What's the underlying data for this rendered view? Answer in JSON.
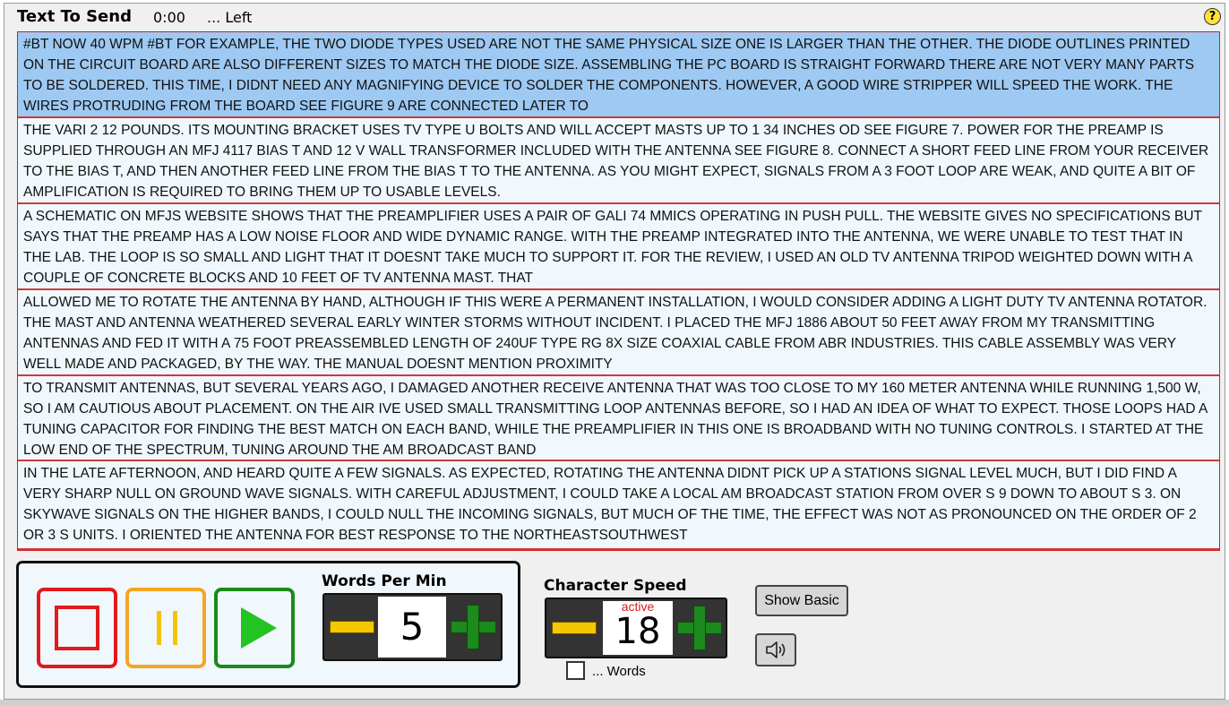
{
  "header": {
    "title": "Text To Send",
    "time": "0:00",
    "remaining": "... Left",
    "help_symbol": "?"
  },
  "text_chunks": [
    {
      "text": "#BT NOW 40 WPM #BT FOR EXAMPLE, THE TWO DIODE TYPES USED ARE NOT THE SAME PHYSICAL SIZE ONE IS LARGER THAN THE OTHER. THE DIODE OUTLINES PRINTED ON THE CIRCUIT BOARD ARE ALSO DIFFERENT SIZES TO MATCH THE DIODE SIZE. ASSEMBLING THE PC BOARD IS STRAIGHT FORWARD THERE ARE NOT VERY MANY PARTS TO BE SOLDERED. THIS TIME, I DIDNT NEED ANY MAGNIFYING DEVICE TO SOLDER THE COMPONENTS. HOWEVER, A GOOD WIRE STRIPPER WILL SPEED THE WORK. THE WIRES PROTRUDING FROM THE BOARD SEE FIGURE 9 ARE CONNECTED LATER TO",
      "selected": true
    },
    {
      "text": "THE VARI 2 12 POUNDS. ITS MOUNTING BRACKET USES TV TYPE U BOLTS AND WILL ACCEPT MASTS UP TO 1 34 INCHES OD SEE FIGURE 7. POWER FOR THE PREAMP IS SUPPLIED THROUGH AN MFJ 4117 BIAS T AND 12 V WALL TRANSFORMER INCLUDED WITH THE ANTENNA SEE FIGURE 8. CONNECT A SHORT FEED LINE FROM YOUR RECEIVER TO THE BIAS T, AND THEN ANOTHER FEED LINE FROM THE BIAS T TO THE ANTENNA. AS YOU MIGHT EXPECT, SIGNALS FROM A 3 FOOT LOOP ARE WEAK, AND QUITE A BIT OF AMPLIFICATION IS REQUIRED TO BRING THEM UP TO USABLE LEVELS.",
      "selected": false
    },
    {
      "text": "A SCHEMATIC ON MFJS WEBSITE SHOWS THAT THE PREAMPLIFIER USES A PAIR OF GALI 74 MMICS OPERATING IN PUSH PULL. THE WEBSITE GIVES NO SPECIFICATIONS BUT SAYS THAT THE PREAMP HAS A LOW NOISE FLOOR AND WIDE DYNAMIC RANGE. WITH THE PREAMP INTEGRATED INTO THE ANTENNA, WE WERE UNABLE TO TEST THAT IN THE LAB. THE LOOP IS SO SMALL AND LIGHT THAT IT DOESNT TAKE MUCH TO SUPPORT IT. FOR THE REVIEW, I USED AN OLD TV ANTENNA TRIPOD WEIGHTED DOWN WITH A COUPLE OF CONCRETE BLOCKS AND 10 FEET OF TV ANTENNA MAST. THAT",
      "selected": false
    },
    {
      "text": "ALLOWED ME TO ROTATE THE ANTENNA BY HAND, ALTHOUGH IF THIS WERE A PERMANENT INSTALLATION, I WOULD CONSIDER ADDING A LIGHT DUTY TV ANTENNA ROTATOR. THE MAST AND ANTENNA WEATHERED SEVERAL EARLY WINTER STORMS WITHOUT INCIDENT. I PLACED THE MFJ 1886 ABOUT 50 FEET AWAY FROM MY TRANSMITTING ANTENNAS AND FED IT WITH A 75 FOOT PREASSEMBLED LENGTH OF 240UF TYPE RG 8X SIZE COAXIAL CABLE FROM ABR INDUSTRIES. THIS CABLE ASSEMBLY WAS VERY WELL MADE AND PACKAGED, BY THE WAY. THE MANUAL DOESNT MENTION PROXIMITY",
      "selected": false
    },
    {
      "text": "TO TRANSMIT ANTENNAS, BUT SEVERAL YEARS AGO, I DAMAGED ANOTHER RECEIVE ANTENNA THAT WAS TOO CLOSE TO MY 160 METER ANTENNA WHILE RUNNING 1,500 W, SO I AM CAUTIOUS ABOUT PLACEMENT. ON THE AIR IVE USED SMALL TRANSMITTING LOOP ANTENNAS BEFORE, SO I HAD AN IDEA OF WHAT TO EXPECT. THOSE LOOPS HAD A TUNING CAPACITOR FOR FINDING THE BEST MATCH ON EACH BAND, WHILE THE PREAMPLIFIER IN THIS ONE IS BROADBAND WITH NO TUNING CONTROLS. I STARTED AT THE LOW END OF THE SPECTRUM, TUNING AROUND THE AM BROADCAST BAND",
      "selected": false
    },
    {
      "text": "IN THE LATE AFTERNOON, AND HEARD QUITE A FEW SIGNALS. AS EXPECTED, ROTATING THE ANTENNA DIDNT PICK UP A STATIONS SIGNAL LEVEL MUCH, BUT I DID FIND A VERY SHARP NULL ON GROUND WAVE SIGNALS. WITH CAREFUL ADJUSTMENT, I COULD TAKE A LOCAL AM BROADCAST STATION FROM OVER S 9 DOWN TO ABOUT S 3. ON SKYWAVE SIGNALS ON THE HIGHER BANDS, I COULD NULL THE INCOMING SIGNALS, BUT MUCH OF THE TIME, THE EFFECT WAS NOT AS PRONOUNCED ON THE ORDER OF 2 OR 3 S UNITS. I ORIENTED THE ANTENNA FOR BEST RESPONSE TO THE NORTHEASTSOUTHWEST",
      "selected": false
    }
  ],
  "playback": {
    "stop_icon": "stop-icon",
    "pause_icon": "pause-icon",
    "play_icon": "play-icon",
    "colors": {
      "stop": "#e21a1a",
      "pause": "#f5a623",
      "play": "#1a8a1a"
    }
  },
  "wpm": {
    "label": "Words Per Min",
    "value": "5"
  },
  "char_speed": {
    "label": "Character Speed",
    "status": "active",
    "value": "18"
  },
  "words_option": {
    "label": "... Words",
    "checked": false
  },
  "buttons": {
    "show_basic": "Show Basic",
    "sound_icon": "speaker-icon"
  }
}
